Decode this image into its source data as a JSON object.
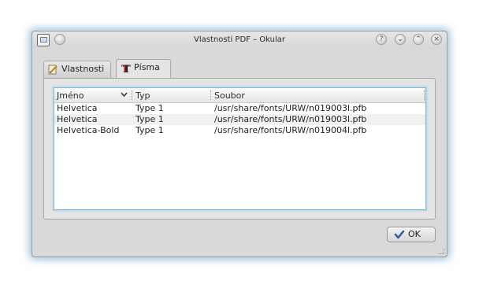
{
  "window": {
    "title": "Vlastnosti PDF – Okular",
    "buttons": {
      "help": "?",
      "minimize": "⌄",
      "maximize": "⌃",
      "close": "×"
    }
  },
  "tabs": [
    {
      "label": "Vlastnosti",
      "icon": "pencil-document-icon",
      "active": false
    },
    {
      "label": "Písma",
      "icon": "font-icon",
      "active": true
    }
  ],
  "fonts_table": {
    "columns": [
      "Jméno",
      "Typ",
      "Soubor"
    ],
    "rows": [
      {
        "name": "Helvetica",
        "type": "Type 1",
        "file": "/usr/share/fonts/URW/n019003l.pfb"
      },
      {
        "name": "Helvetica",
        "type": "Type 1",
        "file": "/usr/share/fonts/URW/n019003l.pfb"
      },
      {
        "name": "Helvetica-Bold",
        "type": "Type 1",
        "file": "/usr/share/fonts/URW/n019004l.pfb"
      }
    ]
  },
  "ok_button": {
    "label": "OK"
  },
  "colors": {
    "accent_glow": "#50a0d2",
    "selection_border": "#7ebbe0"
  }
}
